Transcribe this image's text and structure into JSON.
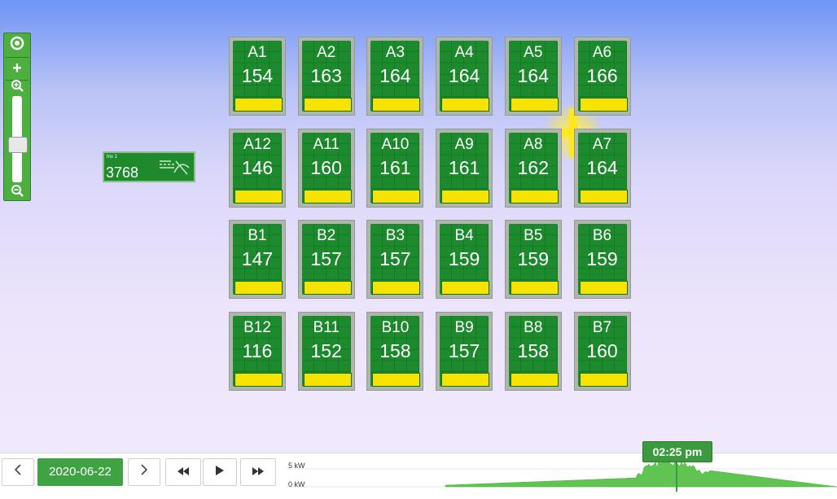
{
  "panels": [
    {
      "name": "A1",
      "value": "154"
    },
    {
      "name": "A2",
      "value": "163"
    },
    {
      "name": "A3",
      "value": "164"
    },
    {
      "name": "A4",
      "value": "164"
    },
    {
      "name": "A5",
      "value": "164"
    },
    {
      "name": "A6",
      "value": "166"
    },
    {
      "name": "A12",
      "value": "146"
    },
    {
      "name": "A11",
      "value": "160"
    },
    {
      "name": "A10",
      "value": "161"
    },
    {
      "name": "A9",
      "value": "161"
    },
    {
      "name": "A8",
      "value": "162"
    },
    {
      "name": "A7",
      "value": "164"
    },
    {
      "name": "B1",
      "value": "147"
    },
    {
      "name": "B2",
      "value": "157"
    },
    {
      "name": "B3",
      "value": "157"
    },
    {
      "name": "B4",
      "value": "159"
    },
    {
      "name": "B5",
      "value": "159"
    },
    {
      "name": "B6",
      "value": "159"
    },
    {
      "name": "B12",
      "value": "116"
    },
    {
      "name": "B11",
      "value": "152"
    },
    {
      "name": "B10",
      "value": "158"
    },
    {
      "name": "B9",
      "value": "157"
    },
    {
      "name": "B8",
      "value": "158"
    },
    {
      "name": "B7",
      "value": "160"
    }
  ],
  "inverter": {
    "name": "Inv 1",
    "value": "3768"
  },
  "zoom": {
    "plus": "+",
    "target_icon": "target-icon",
    "zoom_in_icon": "zoom-in-icon",
    "zoom_out_icon": "zoom-out-icon"
  },
  "date": {
    "label": "2020-06-22"
  },
  "timeline": {
    "current_time": "02:25 pm",
    "y_max_label": "5 kW",
    "y_min_label": "0 kW"
  },
  "colors": {
    "panel_green": "#1d8a2e",
    "bar_yellow": "#f6e400",
    "accent": "#3fa344"
  }
}
